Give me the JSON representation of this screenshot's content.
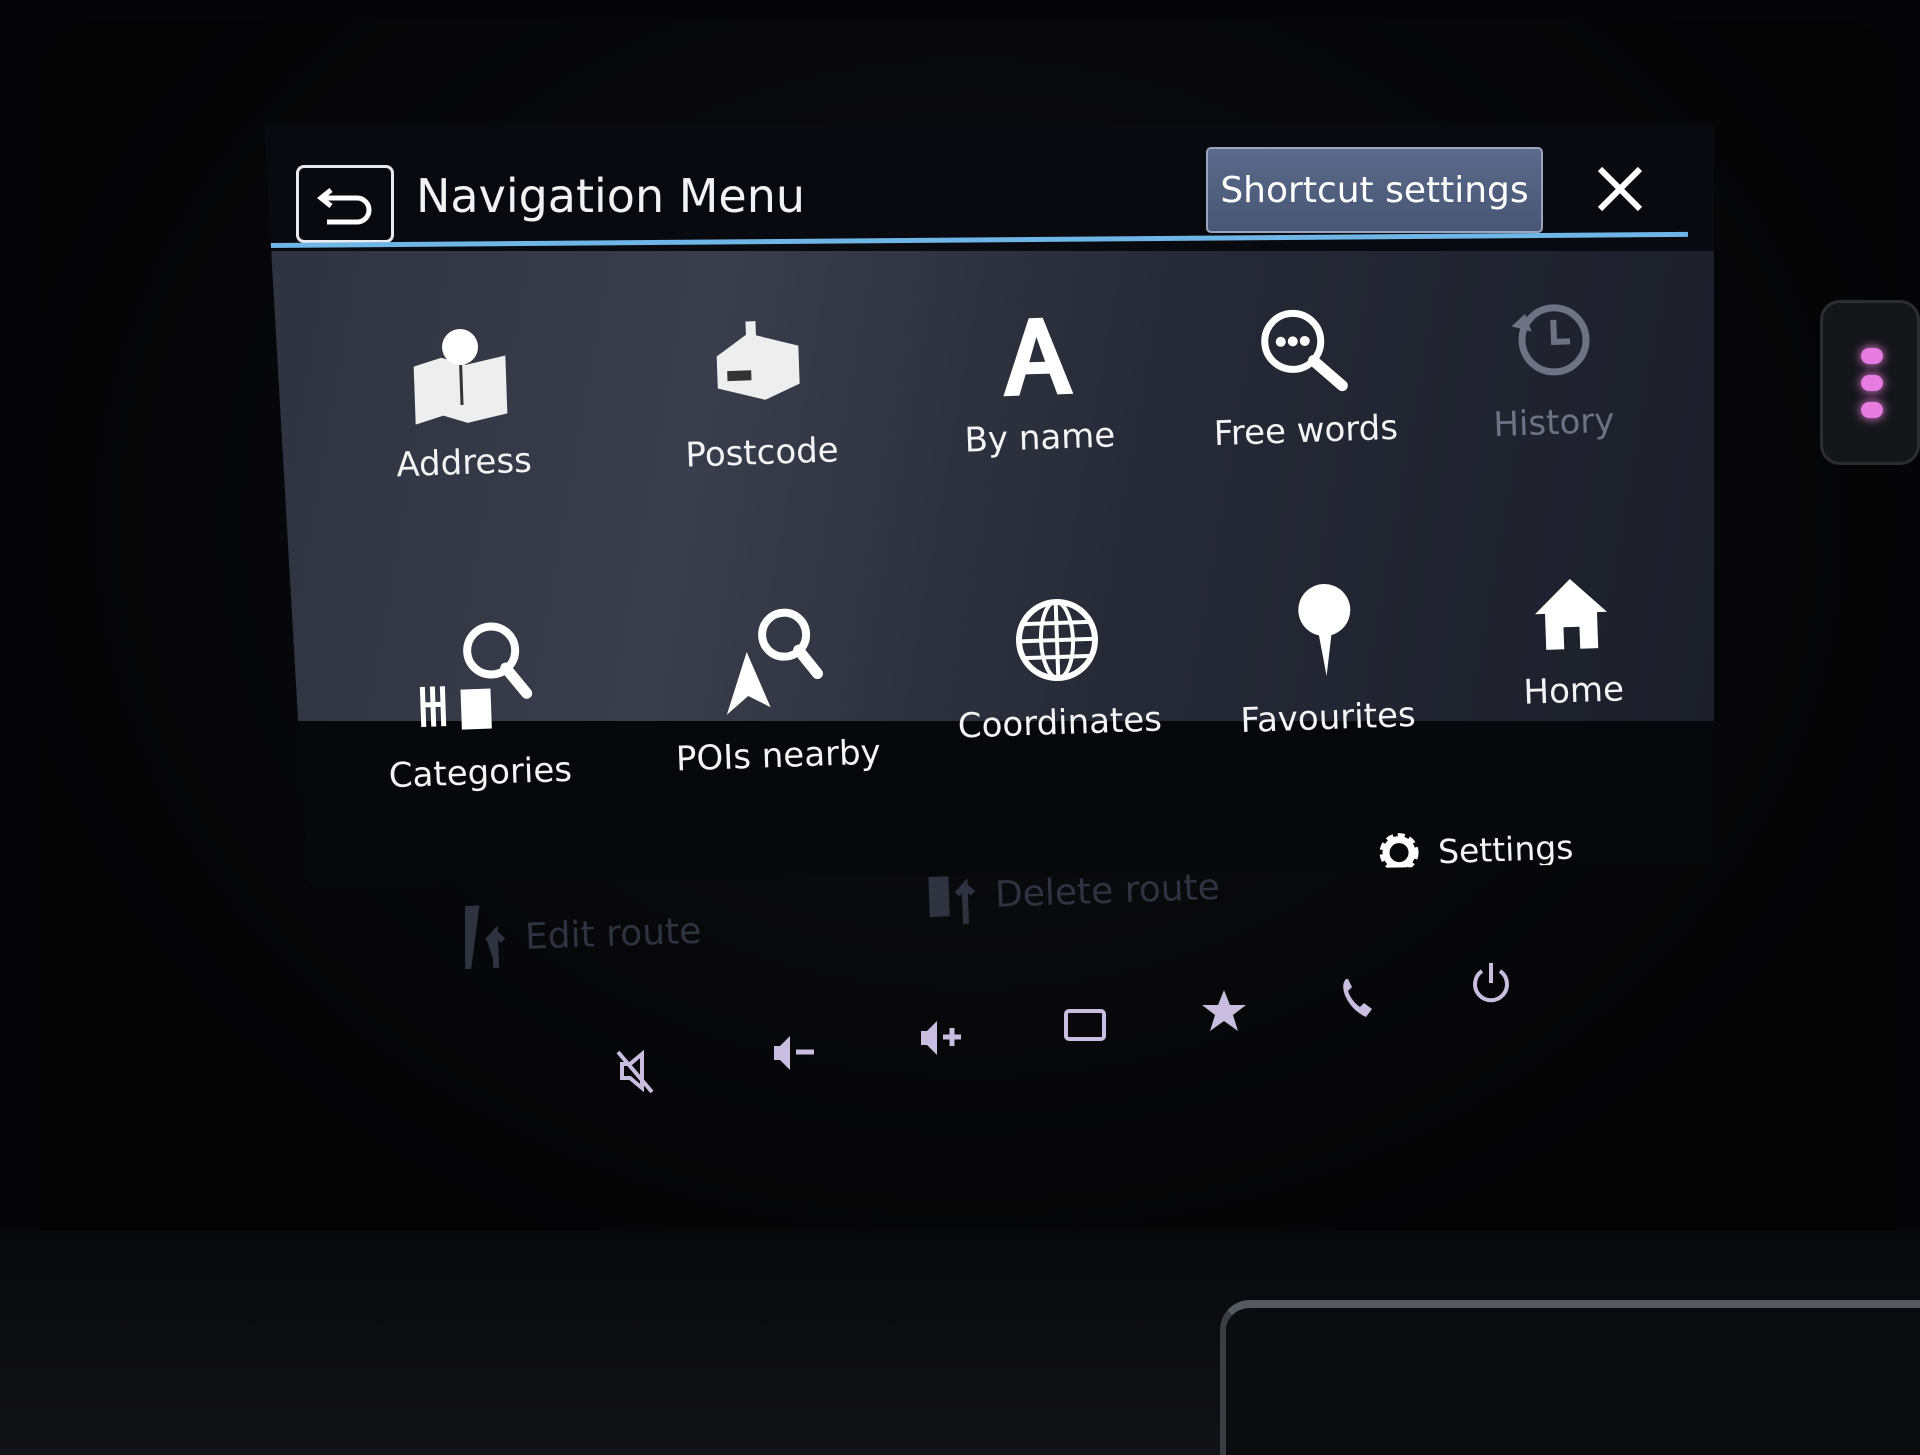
{
  "header": {
    "title": "Navigation Menu",
    "back_icon": "back-arrow-icon",
    "shortcut_settings_label": "Shortcut settings",
    "close_icon": "close-icon",
    "accent_color": "#6fb5e6"
  },
  "menu": {
    "items": [
      {
        "label": "Address",
        "icon": "map-pin-icon",
        "enabled": true
      },
      {
        "label": "Postcode",
        "icon": "mailbox-icon",
        "enabled": true
      },
      {
        "label": "By name",
        "icon": "letter-a-icon",
        "enabled": true
      },
      {
        "label": "Free words",
        "icon": "search-dots-icon",
        "enabled": true
      },
      {
        "label": "History",
        "icon": "history-icon",
        "enabled": false
      },
      {
        "label": "Categories",
        "icon": "categories-search-icon",
        "enabled": true
      },
      {
        "label": "POIs nearby",
        "icon": "poi-nearby-icon",
        "enabled": true
      },
      {
        "label": "Coordinates",
        "icon": "globe-icon",
        "enabled": true
      },
      {
        "label": "Favourites",
        "icon": "pin-icon",
        "enabled": true
      },
      {
        "label": "Home",
        "icon": "home-icon",
        "enabled": true
      }
    ]
  },
  "footer": {
    "settings_label": "Settings",
    "edit_route_label": "Edit route",
    "delete_route_label": "Delete route"
  },
  "hardware_buttons": [
    "mute-icon",
    "volume-down-icon",
    "volume-up-icon",
    "screen-icon",
    "star-icon",
    "phone-icon",
    "power-icon"
  ]
}
